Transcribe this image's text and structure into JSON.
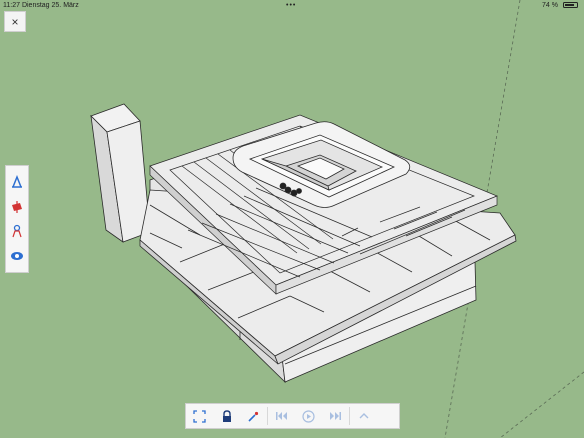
{
  "status_bar": {
    "time_date": "11:27  Dienstag 25. März",
    "dots": "•••",
    "battery_percent_text": "74 %",
    "battery_level": 0.74
  },
  "close_button": {
    "glyph": "×",
    "icon": "close-icon"
  },
  "tool_palette": {
    "items": [
      {
        "name": "tape-measure-tool",
        "icon": "measure-icon",
        "color": "#2d6fd1"
      },
      {
        "name": "section-plane-tool",
        "icon": "section-icon",
        "color": "#d33434"
      },
      {
        "name": "walk-tool",
        "icon": "position-camera-icon",
        "color": "#2d6fd1"
      },
      {
        "name": "look-around-tool",
        "icon": "eye-icon",
        "color": "#2d6fd1"
      }
    ]
  },
  "bottom_toolbar": {
    "items": [
      {
        "name": "zoom-extents-button",
        "icon": "zoom-extents-icon",
        "enabled": true
      },
      {
        "name": "lock-button",
        "icon": "lock-icon",
        "enabled": true
      },
      {
        "name": "magic-wand-button",
        "icon": "wand-icon",
        "enabled": true
      },
      {
        "name": "skip-back-button",
        "icon": "skip-back-icon",
        "enabled": false
      },
      {
        "name": "play-button",
        "icon": "play-icon",
        "enabled": false
      },
      {
        "name": "skip-forward-button",
        "icon": "skip-forward-icon",
        "enabled": false
      },
      {
        "name": "expand-up-button",
        "icon": "chevron-up-icon",
        "enabled": false
      }
    ]
  },
  "colors": {
    "background": "#97b98a",
    "ui_panel": "#f6f6f6",
    "accent_blue": "#2d6fd1",
    "accent_red": "#d33434"
  }
}
